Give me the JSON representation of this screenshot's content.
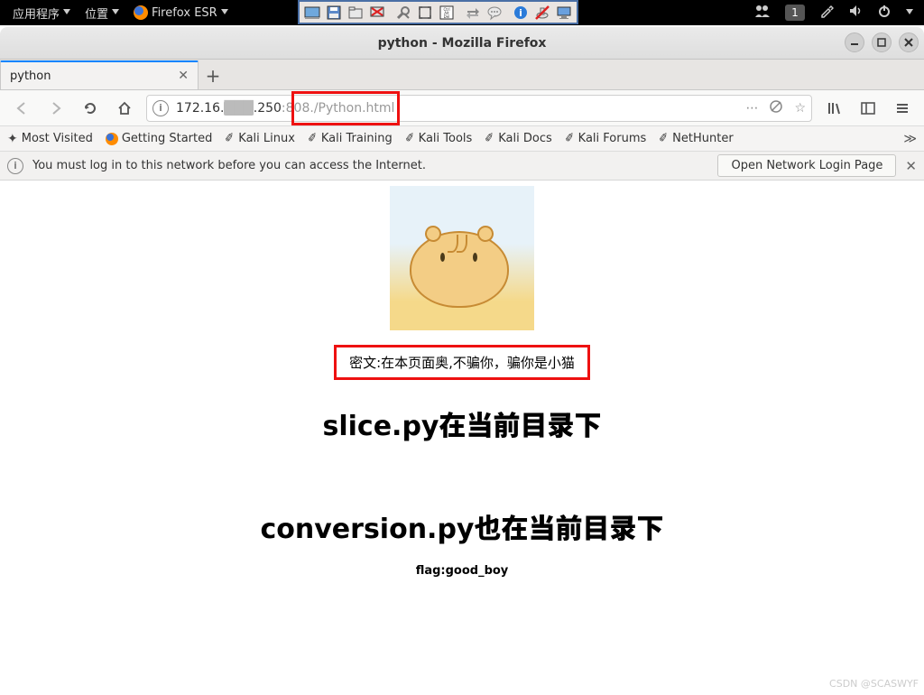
{
  "topbar": {
    "apps": "应用程序",
    "places": "位置",
    "firefox": "Firefox ESR",
    "workspace": "1"
  },
  "window": {
    "title": "python - Mozilla Firefox"
  },
  "tab": {
    "title": "python"
  },
  "url": {
    "host": "172.16.",
    "hostmid": ".250",
    "port": ":808",
    "path": "/Python.html"
  },
  "bookmarks": {
    "most": "Most Visited",
    "start": "Getting Started",
    "k1": "Kali Linux",
    "k2": "Kali Training",
    "k3": "Kali Tools",
    "k4": "Kali Docs",
    "k5": "Kali Forums",
    "k6": "NetHunter"
  },
  "notice": {
    "msg": "You must log in to this network before you can access the Internet.",
    "btn": "Open Network Login Page"
  },
  "content": {
    "cipher": "密文:在本页面奥,不骗你，骗你是小猫",
    "h1": "slice.py在当前目录下",
    "h2": "conversion.py也在当前目录下",
    "flag": "flag:good_boy"
  },
  "watermark": "CSDN @SCASWYF"
}
